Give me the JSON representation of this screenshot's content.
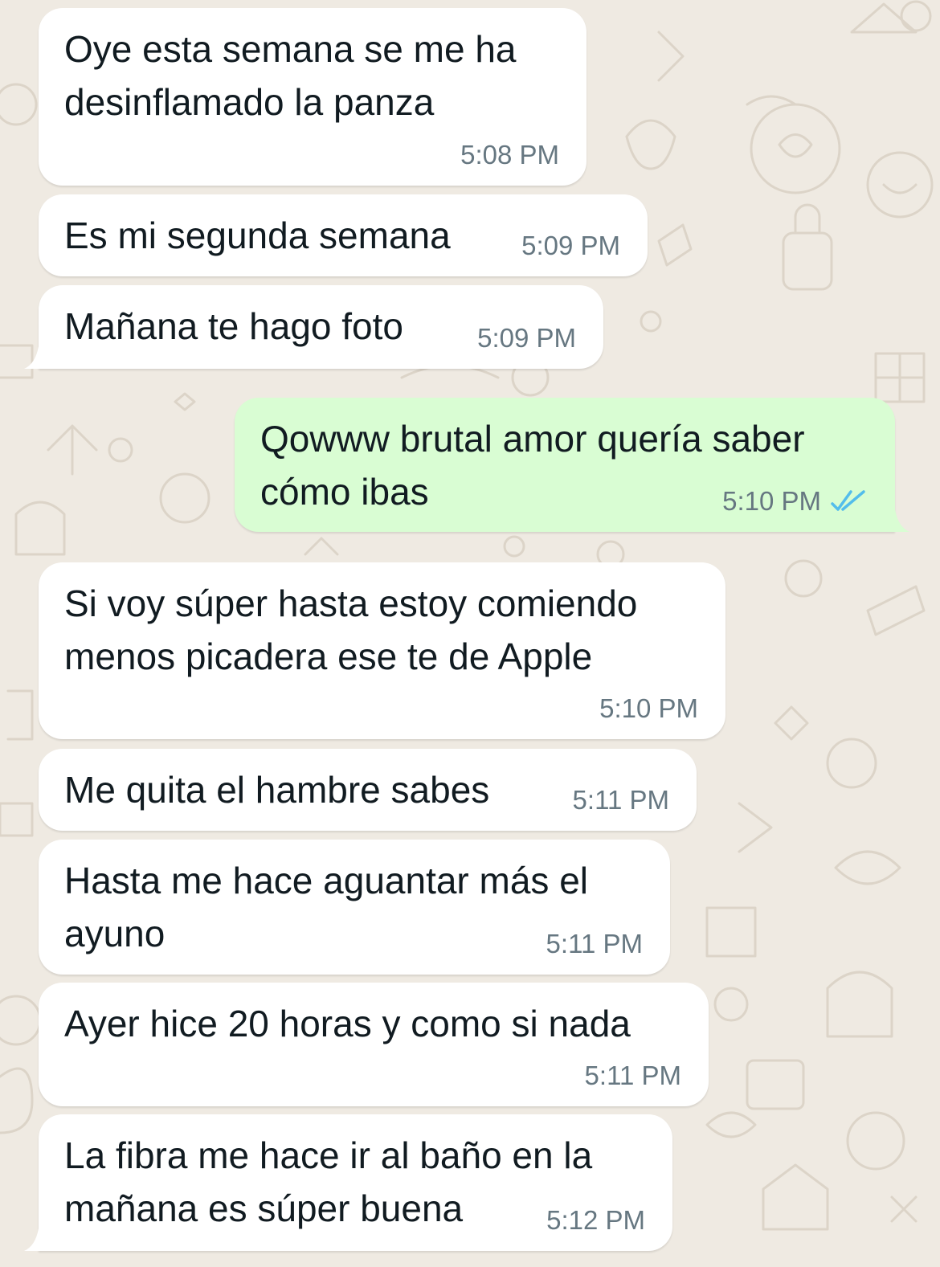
{
  "colors": {
    "background": "#efeae2",
    "incoming_bubble": "#ffffff",
    "outgoing_bubble": "#d9fdd3",
    "message_text": "#111b21",
    "timestamp_text": "#667781",
    "read_ticks": "#53bdeb"
  },
  "messages": [
    {
      "direction": "in",
      "text": "Oye esta semana se me ha\ndesinflamado la panza",
      "time": "5:08 PM"
    },
    {
      "direction": "in",
      "text": "Es mi segunda semana",
      "time": "5:09 PM"
    },
    {
      "direction": "in",
      "text": "Mañana te hago foto",
      "time": "5:09 PM"
    },
    {
      "direction": "out",
      "text": "Qowww brutal amor quería saber\ncómo ibas",
      "time": "5:10 PM",
      "status_icon": "double-check-read-icon"
    },
    {
      "direction": "in",
      "text": "Si voy súper hasta estoy comiendo\nmenos picadera ese te de Apple",
      "time": "5:10 PM"
    },
    {
      "direction": "in",
      "text": "Me quita el hambre sabes",
      "time": "5:11 PM"
    },
    {
      "direction": "in",
      "text": "Hasta me hace aguantar más el\nayuno",
      "time": "5:11 PM"
    },
    {
      "direction": "in",
      "text": "Ayer hice 20 horas y como si nada",
      "time": "5:11 PM"
    },
    {
      "direction": "in",
      "text": "La fibra me hace ir al baño en la\nmañana es súper buena",
      "time": "5:12 PM"
    }
  ]
}
